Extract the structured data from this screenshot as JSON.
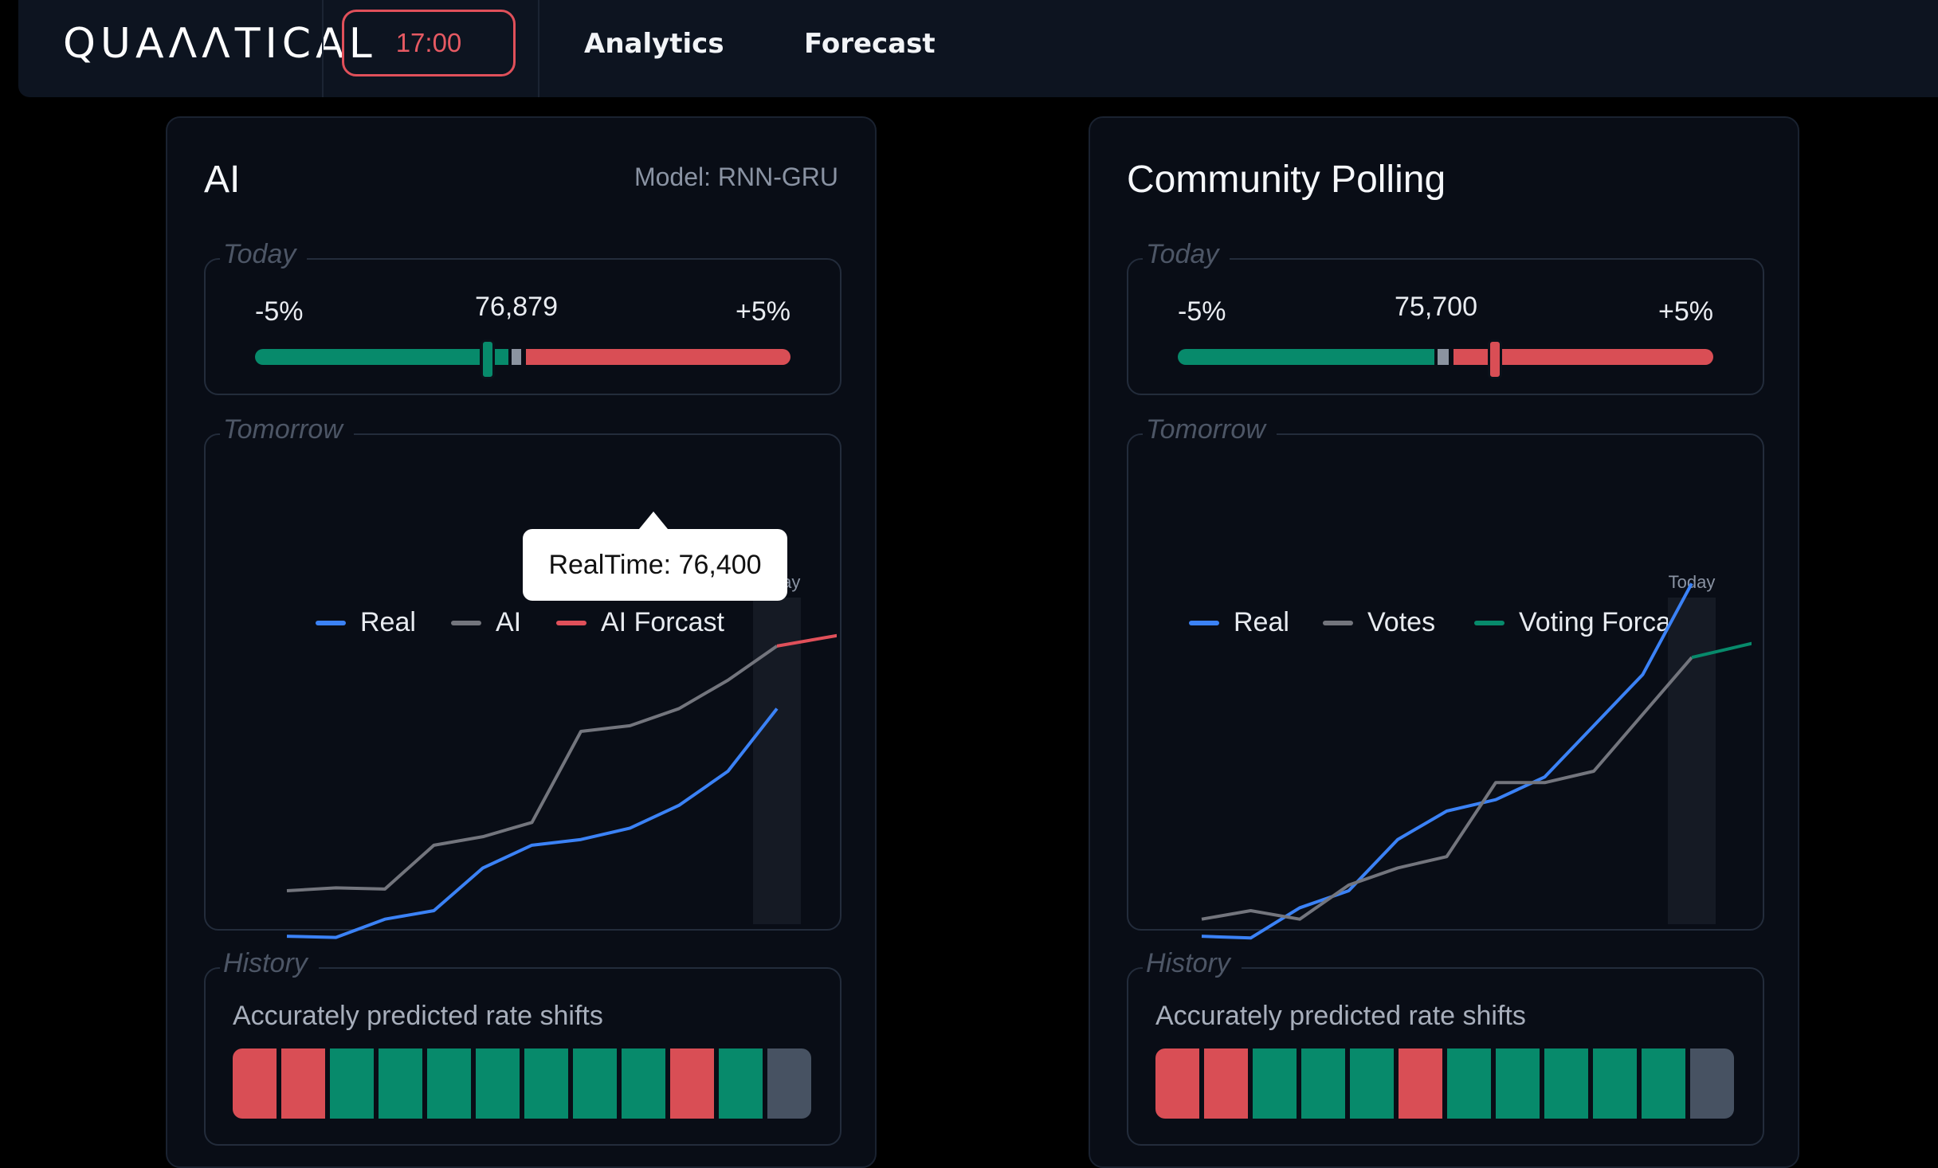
{
  "app": {
    "logo": "QUAΛΛTICAL",
    "time": "17:00",
    "nav": [
      "Analytics",
      "Forecast"
    ]
  },
  "colors": {
    "real": "#3b82f6",
    "gray": "#73757d",
    "forecast_red": "#e0505a",
    "green": "#078a6b",
    "red": "#d94e55",
    "neutral": "#475262"
  },
  "left_card": {
    "title": "AI",
    "model": "Model: RNN-GRU",
    "today": {
      "label": "Today",
      "low": "-5%",
      "high": "+5%",
      "value": "76,879"
    },
    "tooltip": "RealTime: 76,400",
    "tomorrow": {
      "label": "Tomorrow",
      "legend": [
        "Real",
        "AI",
        "AI Forcast"
      ],
      "today_marker": "Today"
    },
    "history": {
      "label": "History",
      "subtitle": "Accurately predicted rate shifts",
      "cells": [
        "red",
        "red",
        "green",
        "green",
        "green",
        "green",
        "green",
        "green",
        "green",
        "red",
        "green",
        "neutral"
      ]
    }
  },
  "right_card": {
    "title": "Community Polling",
    "today": {
      "label": "Today",
      "low": "-5%",
      "high": "+5%",
      "value": "75,700"
    },
    "tomorrow": {
      "label": "Tomorrow",
      "legend": [
        "Real",
        "Votes",
        "Voting Forcast"
      ],
      "today_marker": "Today"
    },
    "history": {
      "label": "History",
      "subtitle": "Accurately predicted rate shifts",
      "cells": [
        "red",
        "red",
        "green",
        "green",
        "green",
        "red",
        "green",
        "green",
        "green",
        "green",
        "green",
        "neutral"
      ]
    }
  },
  "chart_data": [
    {
      "type": "line",
      "x": [
        1,
        2,
        3,
        4,
        5,
        6,
        7,
        8,
        9,
        10,
        11,
        12,
        13
      ],
      "series": [
        {
          "name": "Real",
          "values": [
            6,
            5.8,
            9,
            10.5,
            18,
            22,
            23,
            25,
            29,
            35,
            46,
            null,
            null
          ]
        },
        {
          "name": "AI",
          "values": [
            14,
            14.5,
            14.3,
            22,
            23.5,
            26,
            42,
            43,
            46,
            51,
            57,
            null,
            null
          ]
        },
        {
          "name": "AI Forcast",
          "values": [
            null,
            null,
            null,
            null,
            null,
            null,
            null,
            null,
            null,
            null,
            57,
            58.5,
            60
          ]
        }
      ],
      "today_index": 11,
      "title": "",
      "ylim": [
        0,
        70
      ]
    },
    {
      "type": "line",
      "x": [
        1,
        2,
        3,
        4,
        5,
        6,
        7,
        8,
        9,
        10,
        11,
        12,
        13
      ],
      "series": [
        {
          "name": "Real",
          "values": [
            6,
            5.7,
            11,
            14,
            23,
            28,
            30,
            34,
            43,
            52,
            68,
            null,
            null
          ]
        },
        {
          "name": "Votes",
          "values": [
            9,
            10.5,
            9,
            15,
            18,
            20,
            33,
            33,
            35,
            45,
            55,
            null,
            null
          ]
        },
        {
          "name": "Voting Forcast",
          "values": [
            null,
            null,
            null,
            null,
            null,
            null,
            null,
            null,
            null,
            null,
            55,
            57,
            59
          ]
        }
      ],
      "today_index": 11,
      "title": "",
      "ylim": [
        0,
        70
      ]
    }
  ]
}
